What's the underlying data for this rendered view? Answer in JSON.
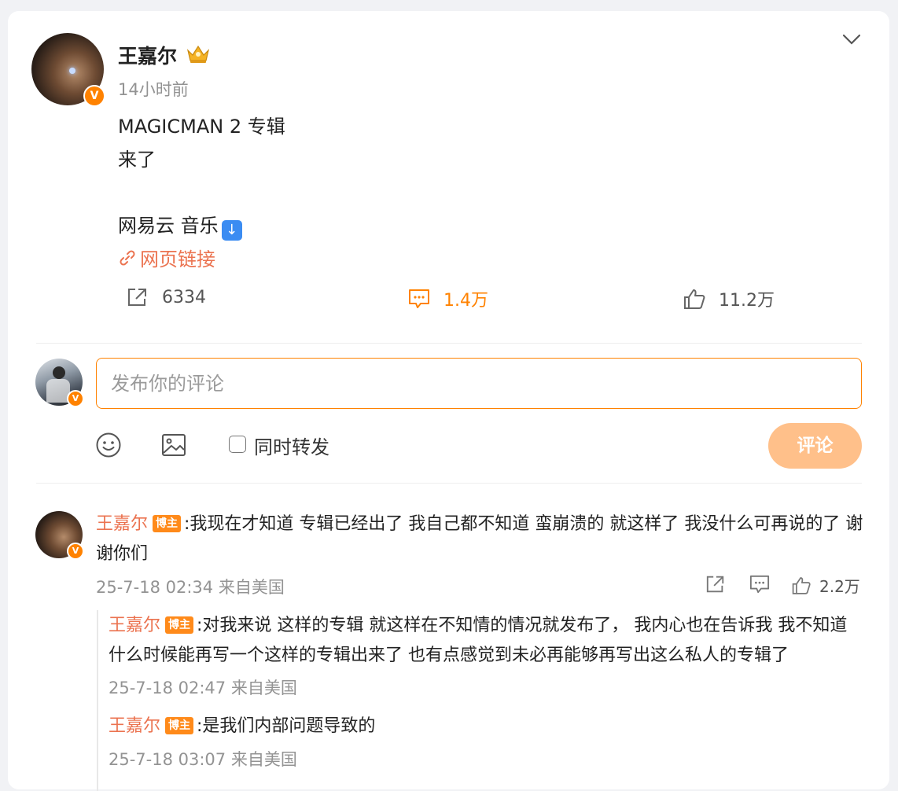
{
  "post": {
    "author": "王嘉尔",
    "time": "14小时前",
    "lines": [
      "MAGICMAN 2 专辑",
      "来了",
      "",
      "网易云 音乐"
    ],
    "link_label": "网页链接",
    "repost_count": "6334",
    "comment_count": "1.4万",
    "like_count": "11.2万"
  },
  "compose": {
    "placeholder": "发布你的评论",
    "repost_label": "同时转发",
    "submit_label": "评论"
  },
  "comments": [
    {
      "author": "王嘉尔",
      "tag": "博主",
      "text": ":我现在才知道 专辑已经出了 我自己都不知道 蛮崩溃的  就这样了 我没什么可再说的了  谢谢你们",
      "meta": "25-7-18 02:34 来自美国",
      "likes": "2.2万",
      "replies": [
        {
          "author": "王嘉尔",
          "tag": "博主",
          "text": ":对我来说 这样的专辑 就这样在不知情的情况就发布了， 我内心也在告诉我 我不知道什么时候能再写一个这样的专辑出来了 也有点感觉到未必再能够再写出这么私人的专辑了",
          "meta": "25-7-18 02:47 来自美国"
        },
        {
          "author": "王嘉尔",
          "tag": "博主",
          "text": ":是我们内部问题导致的",
          "meta": "25-7-18 03:07 来自美国"
        }
      ]
    }
  ],
  "colors": {
    "accent": "#ff8200",
    "link": "#eb7350",
    "button_disabled": "#ffc08a",
    "verified": "#ff8200"
  },
  "icons": [
    "chevron-down-icon",
    "crown-icon",
    "link-icon",
    "repost-icon",
    "comment-icon",
    "like-icon",
    "emoji-icon",
    "image-icon",
    "verified-badge"
  ]
}
